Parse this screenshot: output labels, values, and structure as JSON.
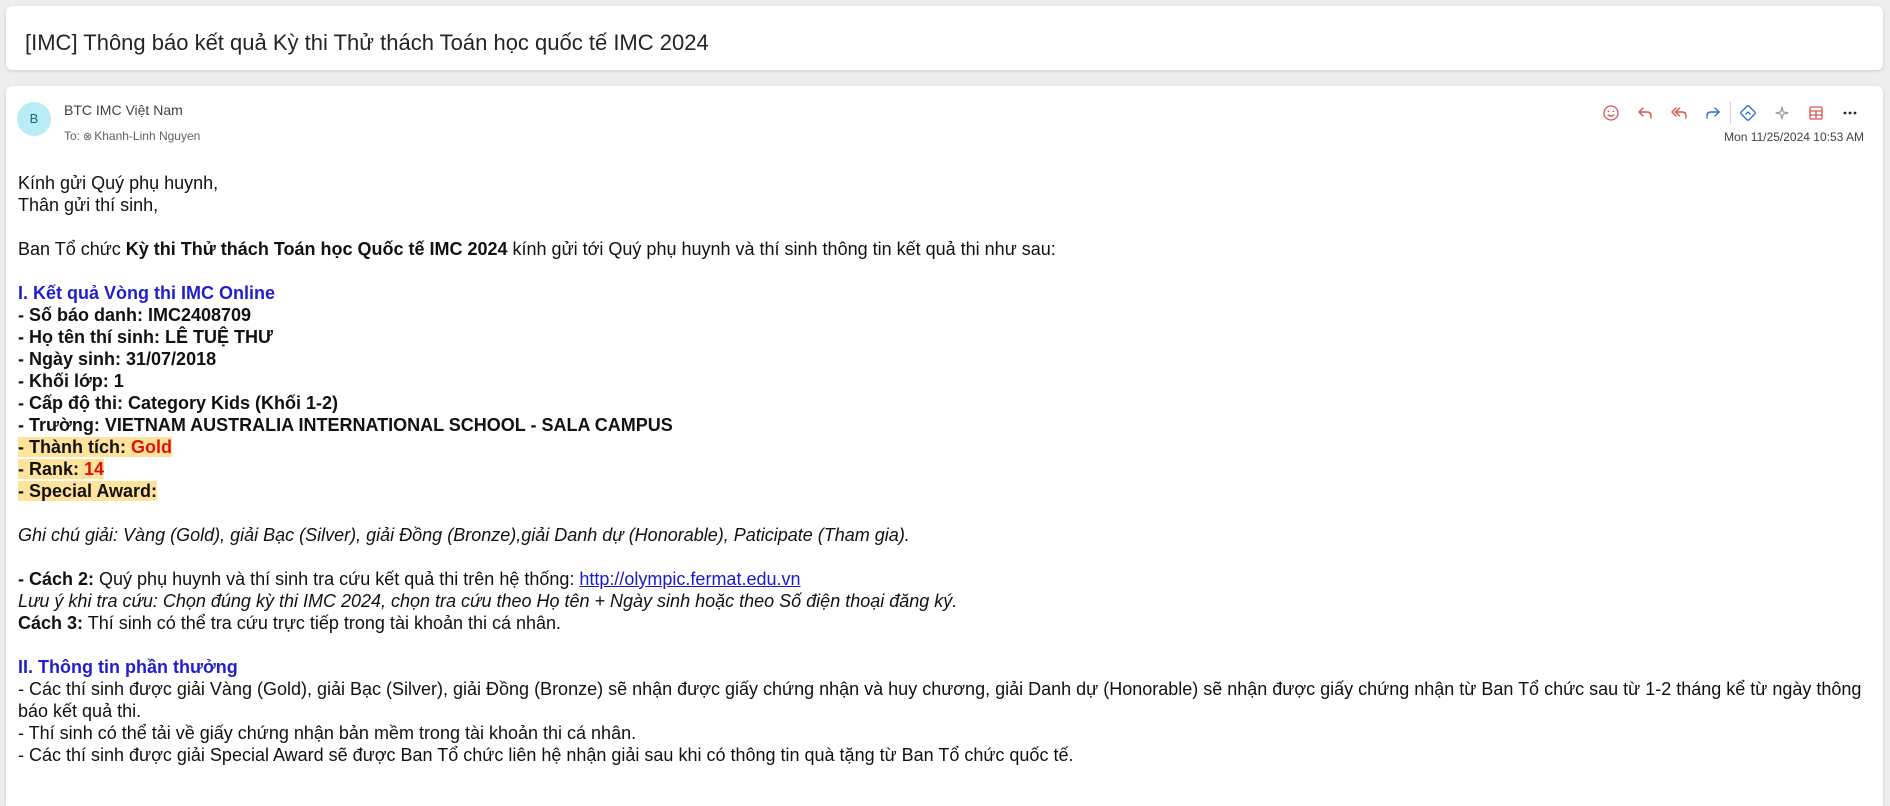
{
  "email": {
    "subject": "[IMC] Thông báo kết quả Kỳ thi Thử thách Toán học quốc tế IMC 2024",
    "sender_initial": "B",
    "sender_name": "BTC IMC Việt Nam",
    "to_label": "To:",
    "recipient": "Khanh-Linh Nguyen",
    "date": "Mon 11/25/2024 10:53 AM"
  },
  "toolbar": {
    "icons": [
      "smiley-icon",
      "reply-icon",
      "reply-all-icon",
      "forward-icon",
      "translate-icon",
      "sparkle-icon",
      "grid-app-icon",
      "more-icon"
    ],
    "more_label": "···"
  },
  "body": {
    "greeting1": "Kính gửi Quý phụ huynh,",
    "greeting2": "Thân gửi thí sinh,",
    "intro_pre": "Ban Tổ chức ",
    "intro_bold": "Kỳ thi Thử thách Toán học Quốc tế IMC 2024",
    "intro_post": " kính gửi tới Quý phụ huynh và thí sinh thông tin kết quả thi như sau:",
    "section1_title": "I. Kết quả Vòng thi IMC Online",
    "details": [
      "- Số báo danh: IMC2408709",
      "- Họ tên thí sinh: LÊ TUỆ THƯ",
      "- Ngày sinh: 31/07/2018",
      "- Khối lớp: 1",
      "- Cấp độ thi: Category Kids (Khối 1-2)",
      "- Trường: VIETNAM AUSTRALIA INTERNATIONAL SCHOOL - SALA CAMPUS"
    ],
    "achievement_label": "- Thành tích: ",
    "achievement_value": "Gold",
    "rank_label": "- Rank: ",
    "rank_value": "14",
    "special_label": "- Special Award:",
    "note": "Ghi chú giải: Vàng (Gold), giải Bạc (Silver), giải Đồng (Bronze),giải Danh dự (Honorable), Paticipate (Tham gia).",
    "method2_label": "- Cách 2:",
    "method2_text": " Quý phụ huynh và thí sinh tra cứu kết quả thi trên hệ thống: ",
    "method2_link": "http://olympic.fermat.edu.vn",
    "lookup_note": "Lưu ý khi tra cứu: Chọn đúng kỳ thi IMC 2024, chọn tra cứu theo Họ tên + Ngày sinh hoặc theo Số điện thoại đăng ký.",
    "method3_label": "Cách 3:",
    "method3_text": " Thí sinh có thể tra cứu trực tiếp trong tài khoản thi cá nhân.",
    "section2_title": "II. Thông tin phần thưởng",
    "awards": [
      "- Các thí sinh được giải Vàng (Gold), giải Bạc (Silver), giải Đồng (Bronze) sẽ nhận được giấy chứng nhận và huy chương, giải Danh dự (Honorable) sẽ nhận được giấy chứng nhận từ Ban Tổ chức sau từ 1-2 tháng kể từ ngày thông báo kết quả thi.",
      "- Thí sinh có thể tải về giấy chứng nhận bản mềm trong tài khoản thi cá nhân.",
      "- Các thí sinh được giải Special Award sẽ được Ban Tổ chức liên hệ nhận giải sau khi có thông tin quà tặng từ Ban Tổ chức quốc tế."
    ]
  },
  "colors": {
    "section_title": "#1f1fd0",
    "highlight": "#ffe39a",
    "result_red": "#e01010",
    "link": "#1a1acc",
    "avatar_bg": "#b9ecf4",
    "icon_red": "#d9534f",
    "icon_blue": "#2f6fd6"
  }
}
